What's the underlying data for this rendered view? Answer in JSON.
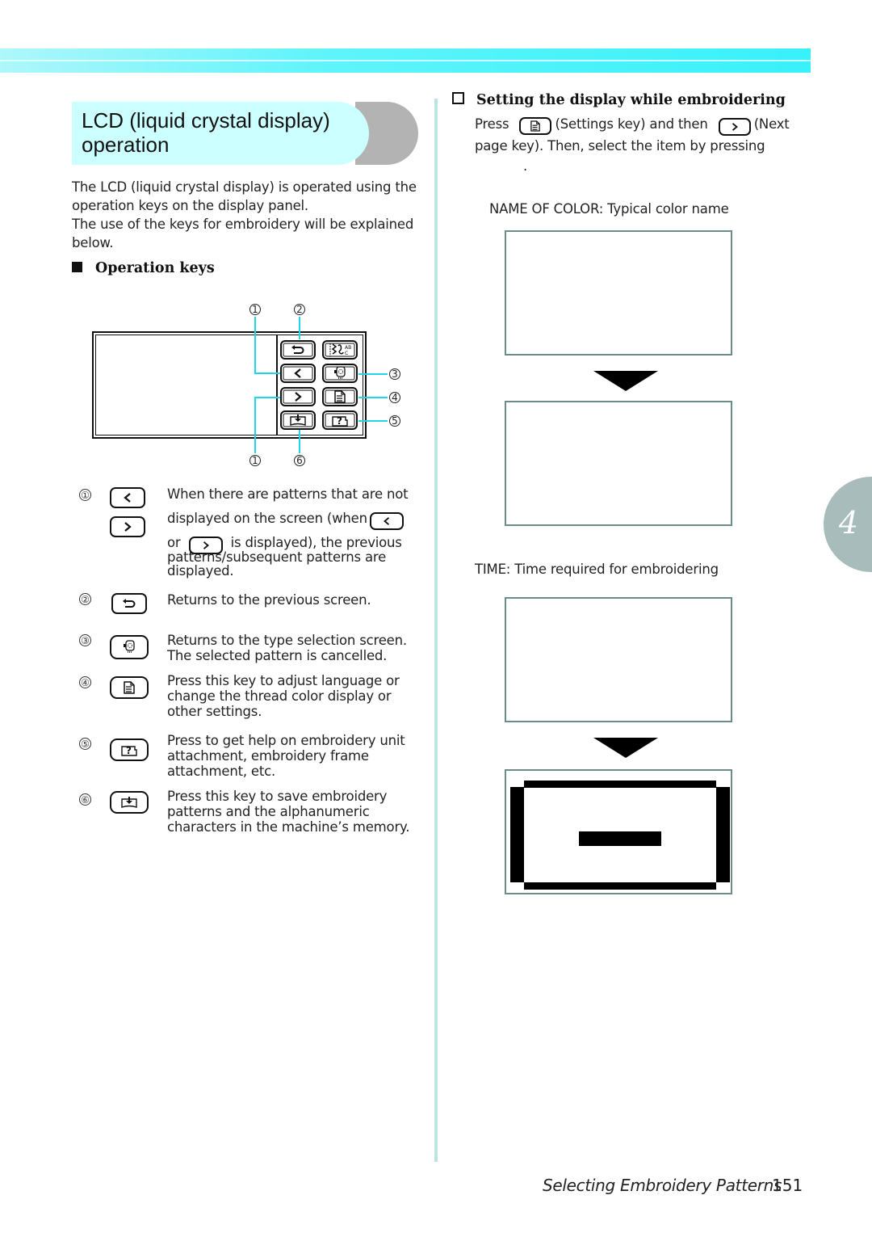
{
  "section": {
    "title_line1": "LCD (liquid crystal display)",
    "title_line2": "operation",
    "intro_line1": "The LCD (liquid crystal display) is operated using the",
    "intro_line2": "operation keys on the display panel.",
    "intro_line3": "The use of the keys for embroidery will be explained",
    "intro_line4": "below."
  },
  "operation_keys": {
    "heading": "Operation keys",
    "diagram_callouts": [
      "1",
      "2",
      "3",
      "4",
      "5",
      "1",
      "6"
    ],
    "panel_keys": [
      {
        "icon": "back-arrow-icon",
        "name": "back-key"
      },
      {
        "icon": "stitch-type-icon",
        "name": "stitch-type-key"
      },
      {
        "icon": "previous-page-icon",
        "name": "previous-page-key"
      },
      {
        "icon": "embroidery-type-icon",
        "name": "embroidery-type-key"
      },
      {
        "icon": "next-page-icon",
        "name": "next-page-key"
      },
      {
        "icon": "settings-icon",
        "name": "settings-key"
      },
      {
        "icon": "save-memory-icon",
        "name": "memory-key"
      },
      {
        "icon": "help-icon",
        "name": "help-key"
      }
    ],
    "legend": [
      {
        "num": "①",
        "icons": [
          "previous-page-icon",
          "next-page-icon"
        ],
        "line1": "When there are patterns that are not",
        "line2a": "displayed on the screen (when",
        "line3a": "or",
        "line3b": "is displayed), the previous",
        "line4": "patterns/subsequent patterns are",
        "line5": "displayed."
      },
      {
        "num": "②",
        "icon": "back-arrow-icon",
        "line1": "Returns to the previous screen."
      },
      {
        "num": "③",
        "icon": "embroidery-type-icon",
        "line1": "Returns to the type selection screen.",
        "line2": "The selected pattern is cancelled."
      },
      {
        "num": "④",
        "icon": "settings-icon",
        "line1": "Press this key to adjust language or",
        "line2": "change the thread color display or",
        "line3": "other settings."
      },
      {
        "num": "⑤",
        "icon": "help-icon",
        "line1": "Press to get help on embroidery unit",
        "line2": "attachment, embroidery frame",
        "line3": "attachment, etc."
      },
      {
        "num": "⑥",
        "icon": "save-memory-icon",
        "line1": "Press this key to save embroidery",
        "line2": "patterns and the alphanumeric",
        "line3": "characters in the machine’s memory."
      }
    ]
  },
  "display_setting": {
    "heading": "Setting the display while embroidering",
    "press": "Press",
    "settings_key_label": "(Settings key) and then",
    "next_key_label": "(Next",
    "line2": "page key). Then, select the item by pressing",
    "line3": ".",
    "name_of_color_caption": "NAME OF COLOR: Typical color name",
    "time_caption": "TIME: Time required for embroidering"
  },
  "chapter_tab": {
    "number": "4"
  },
  "footer": {
    "title": "Selecting Embroidery Patterns",
    "page": "151"
  },
  "colors": {
    "accent_cyan": "#38f1fa",
    "title_bg": "#ccffff",
    "tab_gray": "#a8bcbc",
    "divider": "#bfe3e3"
  }
}
